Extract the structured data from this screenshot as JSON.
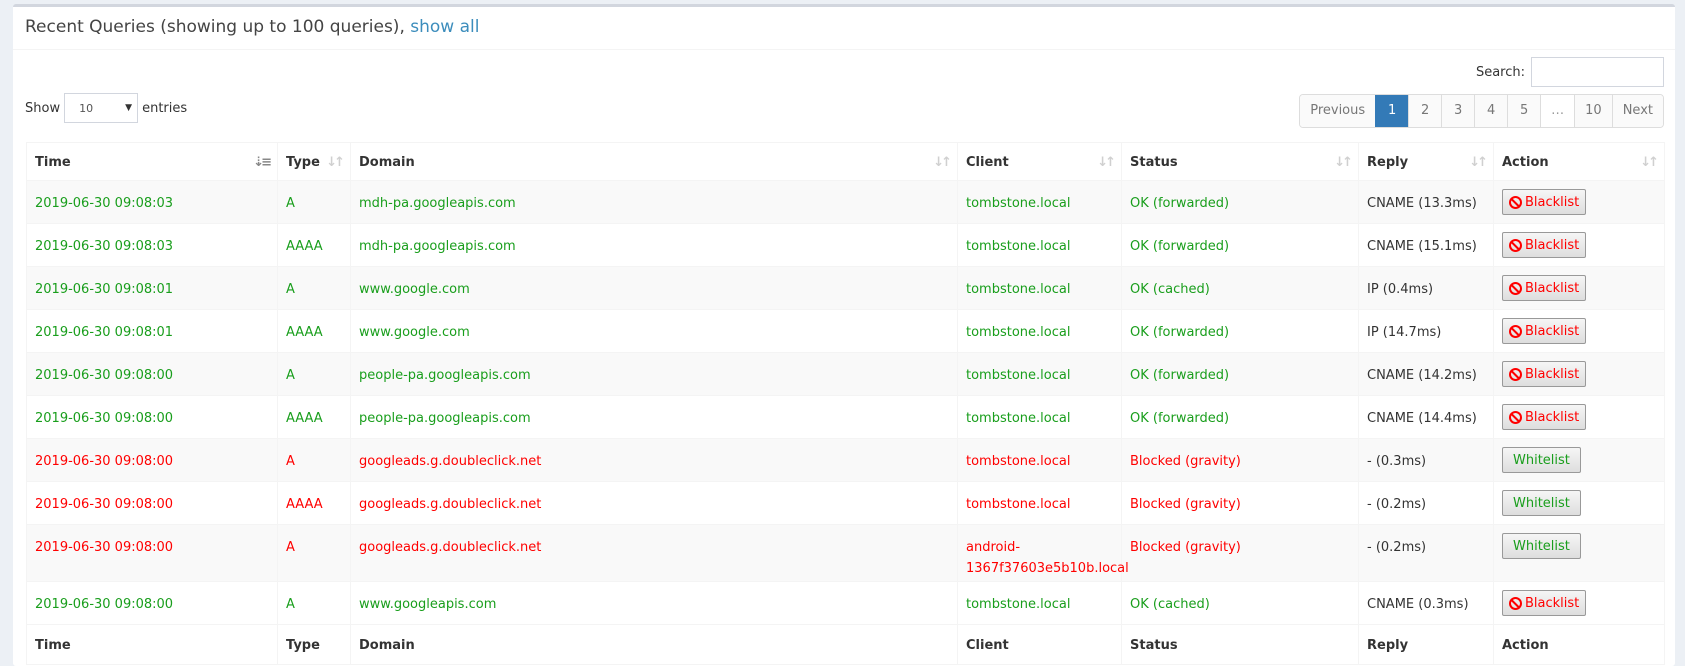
{
  "header": {
    "title": "Recent Queries (showing up to 100 queries),",
    "show_all_link": "show all"
  },
  "search": {
    "label": "Search:",
    "value": "",
    "placeholder": ""
  },
  "length": {
    "show_label": "Show",
    "selected": "10",
    "entries_label": "entries"
  },
  "pagination": {
    "previous": "Previous",
    "pages": [
      "1",
      "2",
      "3",
      "4",
      "5",
      "…",
      "10"
    ],
    "active_page": "1",
    "next": "Next"
  },
  "columns": [
    "Time",
    "Type",
    "Domain",
    "Client",
    "Status",
    "Reply",
    "Action"
  ],
  "sorted_column": "Time",
  "colors": {
    "ok": "#199e1c",
    "blocked": "#ff0000",
    "active_page": "#337ab7",
    "link": "#3c8dbc"
  },
  "rows": [
    {
      "time": "2019-06-30 09:08:03",
      "type": "A",
      "domain": "mdh-pa.googleapis.com",
      "client": "tombstone.local",
      "status": "OK (forwarded)",
      "reply": "CNAME (13.3ms)",
      "action": "Blacklist",
      "state": "ok"
    },
    {
      "time": "2019-06-30 09:08:03",
      "type": "AAAA",
      "domain": "mdh-pa.googleapis.com",
      "client": "tombstone.local",
      "status": "OK (forwarded)",
      "reply": "CNAME (15.1ms)",
      "action": "Blacklist",
      "state": "ok"
    },
    {
      "time": "2019-06-30 09:08:01",
      "type": "A",
      "domain": "www.google.com",
      "client": "tombstone.local",
      "status": "OK (cached)",
      "reply": "IP (0.4ms)",
      "action": "Blacklist",
      "state": "ok"
    },
    {
      "time": "2019-06-30 09:08:01",
      "type": "AAAA",
      "domain": "www.google.com",
      "client": "tombstone.local",
      "status": "OK (forwarded)",
      "reply": "IP (14.7ms)",
      "action": "Blacklist",
      "state": "ok"
    },
    {
      "time": "2019-06-30 09:08:00",
      "type": "A",
      "domain": "people-pa.googleapis.com",
      "client": "tombstone.local",
      "status": "OK (forwarded)",
      "reply": "CNAME (14.2ms)",
      "action": "Blacklist",
      "state": "ok"
    },
    {
      "time": "2019-06-30 09:08:00",
      "type": "AAAA",
      "domain": "people-pa.googleapis.com",
      "client": "tombstone.local",
      "status": "OK (forwarded)",
      "reply": "CNAME (14.4ms)",
      "action": "Blacklist",
      "state": "ok"
    },
    {
      "time": "2019-06-30 09:08:00",
      "type": "A",
      "domain": "googleads.g.doubleclick.net",
      "client": "tombstone.local",
      "status": "Blocked (gravity)",
      "reply": "- (0.3ms)",
      "action": "Whitelist",
      "state": "blocked"
    },
    {
      "time": "2019-06-30 09:08:00",
      "type": "AAAA",
      "domain": "googleads.g.doubleclick.net",
      "client": "tombstone.local",
      "status": "Blocked (gravity)",
      "reply": "- (0.2ms)",
      "action": "Whitelist",
      "state": "blocked"
    },
    {
      "time": "2019-06-30 09:08:00",
      "type": "A",
      "domain": "googleads.g.doubleclick.net",
      "client": "android-1367f37603e5b10b.local",
      "status": "Blocked (gravity)",
      "reply": "- (0.2ms)",
      "action": "Whitelist",
      "state": "blocked"
    },
    {
      "time": "2019-06-30 09:08:00",
      "type": "A",
      "domain": "www.googleapis.com",
      "client": "tombstone.local",
      "status": "OK (cached)",
      "reply": "CNAME (0.3ms)",
      "action": "Blacklist",
      "state": "ok"
    }
  ]
}
